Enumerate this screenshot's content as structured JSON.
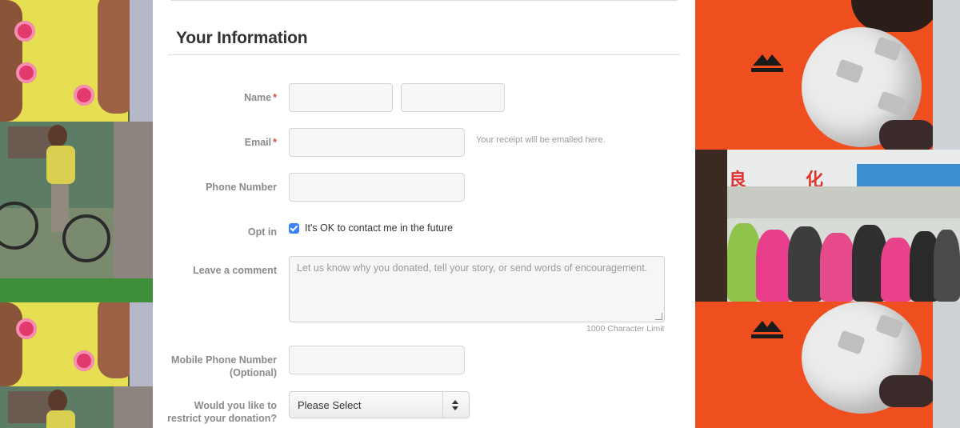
{
  "section": {
    "title": "Your Information"
  },
  "fields": {
    "name": {
      "label": "Name",
      "required_mark": "*",
      "first_value": "",
      "last_value": ""
    },
    "email": {
      "label": "Email",
      "required_mark": "*",
      "value": "",
      "hint": "Your receipt will be emailed here."
    },
    "phone": {
      "label": "Phone Number",
      "value": ""
    },
    "optin": {
      "label": "Opt in",
      "checkbox_label": "It's OK to contact me in the future",
      "checked": true
    },
    "comment": {
      "label": "Leave a comment",
      "placeholder": "Let us know why you donated, tell your story, or send words of encouragement.",
      "char_limit": "1000 Character Limit"
    },
    "mobile": {
      "label_line1": "Mobile Phone Number",
      "label_line2": "(Optional)",
      "value": ""
    },
    "restrict": {
      "label_line1": "Would you like to",
      "label_line2": "restrict your donation?",
      "selected": "Please Select"
    }
  },
  "colors": {
    "required": "#d24b4b",
    "checkbox": "#3b82f6",
    "orange_photo": "#ef4f1e"
  }
}
